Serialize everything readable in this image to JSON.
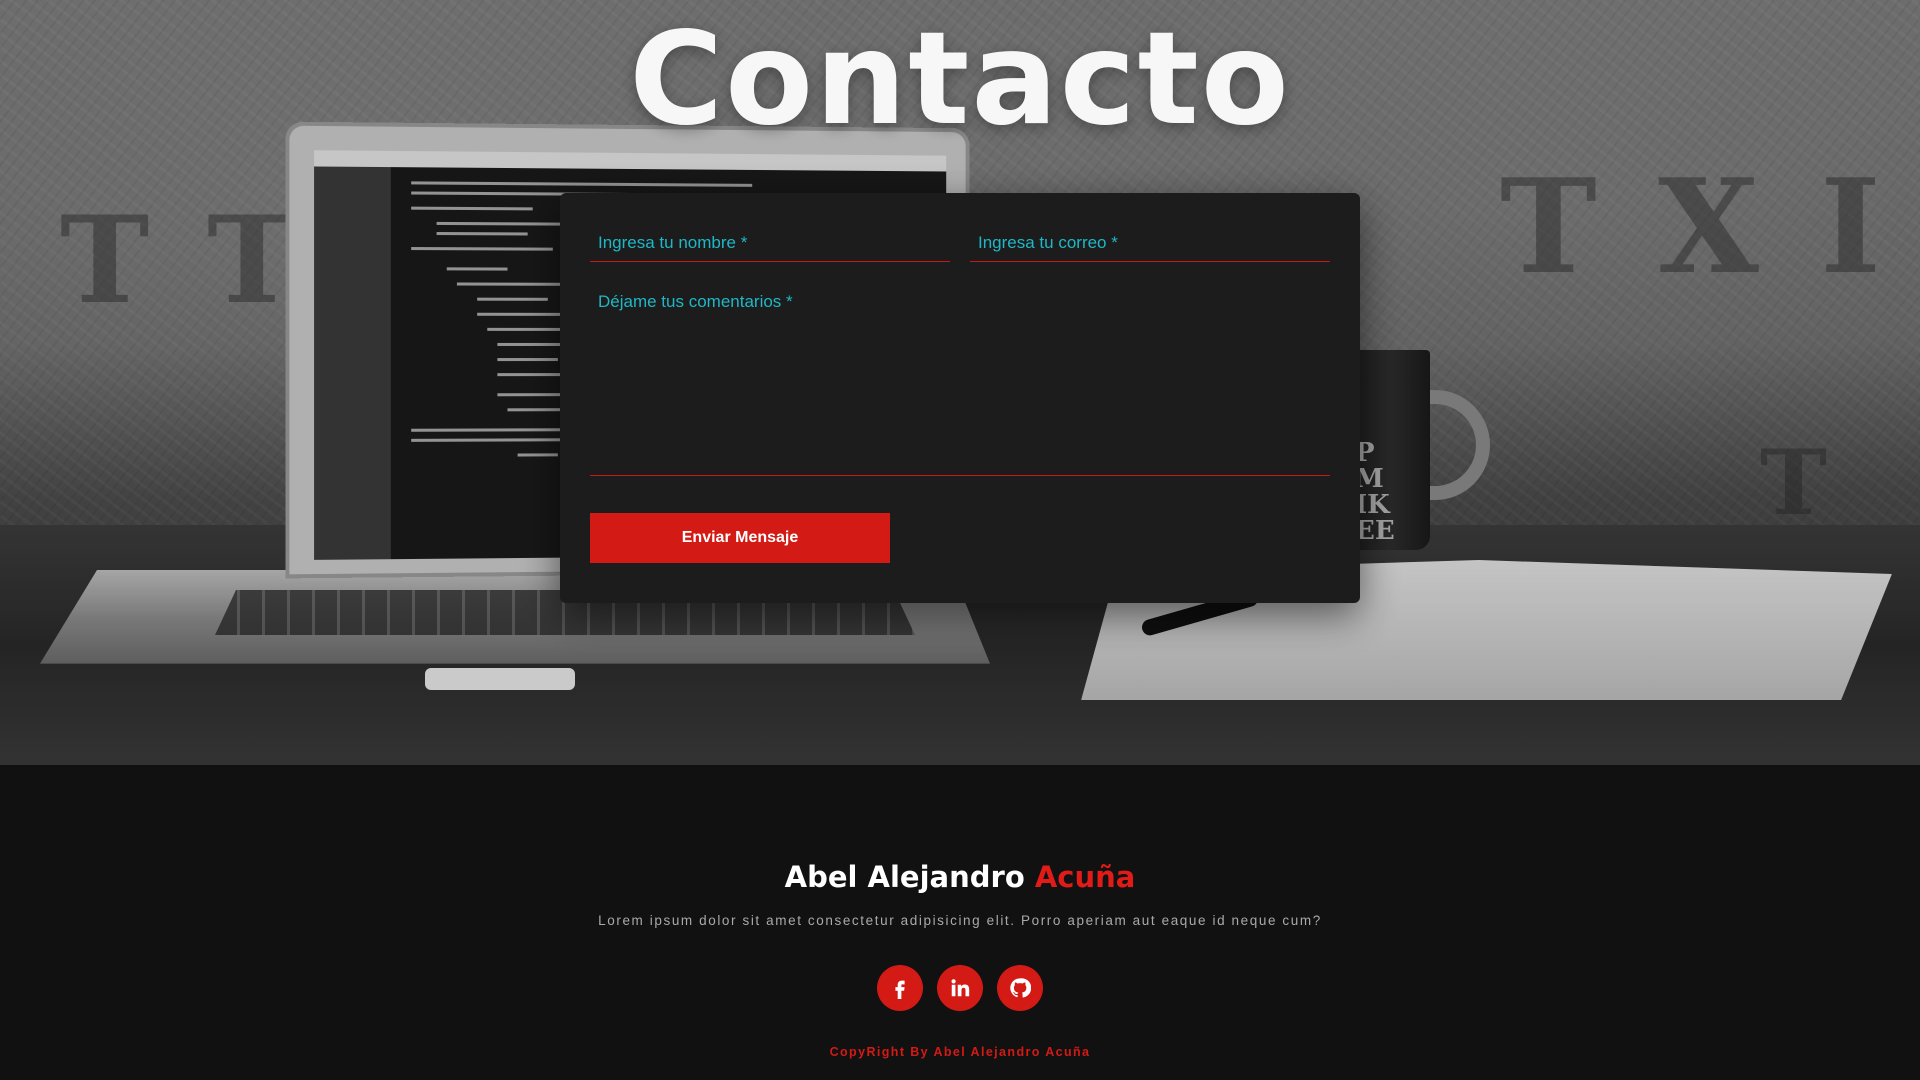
{
  "hero": {
    "title": "Contacto"
  },
  "background_scene": {
    "mug_text": "P\nM\nIK\nEE"
  },
  "form": {
    "name_placeholder": "Ingresa tu nombre *",
    "email_placeholder": "Ingresa tu correo *",
    "comments_placeholder": "Déjame tus comentarios *",
    "submit_label": "Enviar Mensaje"
  },
  "footer": {
    "name_first": "Abel Alejandro",
    "name_accent": "Acuña",
    "description": "Lorem ipsum dolor sit amet consectetur adipisicing elit. Porro aperiam aut eaque id neque cum?",
    "social": [
      {
        "name": "facebook",
        "icon": "facebook-icon"
      },
      {
        "name": "linkedin",
        "icon": "linkedin-icon"
      },
      {
        "name": "github",
        "icon": "github-icon"
      }
    ],
    "copyright": "CopyRight By Abel Alejandro Acuña"
  },
  "colors": {
    "accent_red": "#d41a14",
    "placeholder_cyan": "#1fb7c5",
    "form_bg": "#1c1c1d",
    "footer_bg": "#111112"
  }
}
